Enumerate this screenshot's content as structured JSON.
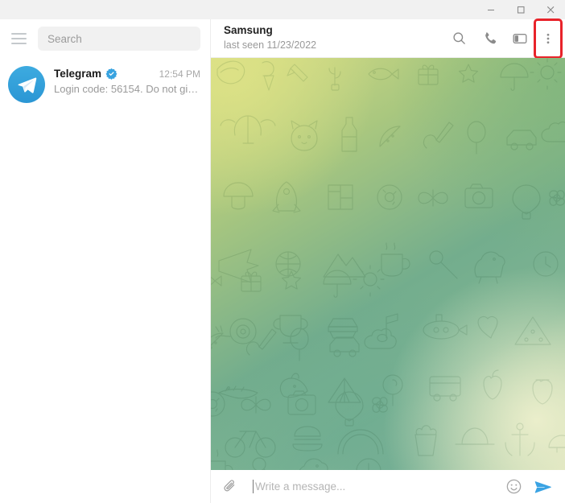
{
  "window": {
    "minimize_label": "Minimize",
    "maximize_label": "Maximize",
    "close_label": "Close"
  },
  "sidebar": {
    "menu_label": "Menu",
    "search": {
      "placeholder": "Search",
      "value": ""
    },
    "chats": [
      {
        "avatar_type": "telegram-logo",
        "title": "Telegram",
        "verified": true,
        "time": "12:54 PM",
        "preview": "Login code: 56154. Do not giv..."
      }
    ]
  },
  "chat": {
    "peer_name": "Samsung",
    "peer_status": "last seen 11/23/2022",
    "header_actions": [
      {
        "name": "search-icon",
        "label": "Search messages"
      },
      {
        "name": "phone-icon",
        "label": "Call"
      },
      {
        "name": "panel-icon",
        "label": "Toggle info panel"
      },
      {
        "name": "more-menu-icon",
        "label": "More",
        "highlighted": true
      }
    ],
    "highlight_color": "#e8232a",
    "background": {
      "style": "telegram-doodle-pattern",
      "gradient_from": "#d8dd84",
      "gradient_mid": "#73ad8d",
      "gradient_to": "#dde2b8"
    },
    "messages": []
  },
  "composer": {
    "attach_label": "Attach file",
    "placeholder": "Write a message...",
    "value": "",
    "emoji_label": "Emoji",
    "send_label": "Send",
    "send_color": "#3aa3e3"
  }
}
